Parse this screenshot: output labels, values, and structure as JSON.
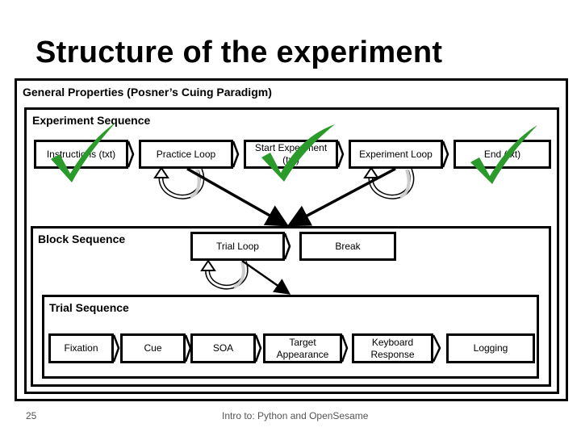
{
  "slide": {
    "title": "Structure of the experiment",
    "page_number": "25",
    "footer_text": "Intro to: Python and OpenSesame"
  },
  "frames": {
    "general": "General Properties (Posner’s Cuing Paradigm)",
    "experiment": "Experiment Sequence",
    "block": "Block Sequence",
    "trial": "Trial Sequence"
  },
  "experiment_sequence": [
    {
      "label": "Instructions (txt)",
      "checked": true
    },
    {
      "label": "Practice Loop",
      "checked": false
    },
    {
      "label": "Start Experiment (txt)",
      "checked": true
    },
    {
      "label": "Experiment Loop",
      "checked": false
    },
    {
      "label": "End (txt)",
      "checked": true
    }
  ],
  "block_sequence": [
    {
      "label": "Trial Loop"
    },
    {
      "label": "Break"
    }
  ],
  "trial_sequence": [
    {
      "label": "Fixation"
    },
    {
      "label": "Cue"
    },
    {
      "label": "SOA"
    },
    {
      "label": "Target Appearance"
    },
    {
      "label": "Keyboard Response"
    },
    {
      "label": "Logging"
    }
  ],
  "colors": {
    "checkmark": "#2a9a2a",
    "loop_arrow_fill": "#cccccc"
  },
  "icons": {
    "checkmark": "checkmark-icon",
    "loop": "loop-arrow-icon"
  }
}
